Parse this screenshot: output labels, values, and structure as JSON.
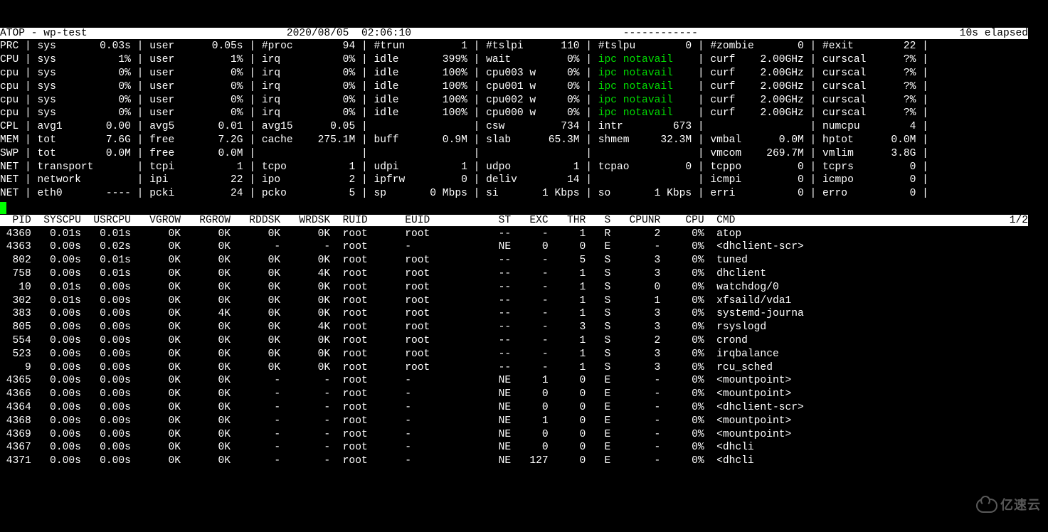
{
  "watermark": "亿速云",
  "header": {
    "left": "ATOP - wp-test",
    "date": "2020/08/05",
    "time": "02:06:10",
    "dashes": "------------",
    "elapsed": "10s elapsed"
  },
  "sys_rows": [
    {
      "tag": "PRC",
      "cols": [
        {
          "l": "sys",
          "v": "0.03s"
        },
        {
          "l": "user",
          "v": "0.05s"
        },
        {
          "l": "#proc",
          "v": "94"
        },
        {
          "l": "#trun",
          "v": "1"
        },
        {
          "l": "#tslpi",
          "v": "110"
        },
        {
          "l": "#tslpu",
          "v": "0"
        },
        {
          "l": "#zombie",
          "v": "0"
        },
        {
          "l": "#exit",
          "v": "22"
        }
      ]
    },
    {
      "tag": "CPU",
      "cols": [
        {
          "l": "sys",
          "v": "1%"
        },
        {
          "l": "user",
          "v": "1%"
        },
        {
          "l": "irq",
          "v": "0%"
        },
        {
          "l": "idle",
          "v": "399%"
        },
        {
          "l": "wait",
          "v": "0%"
        },
        {
          "l": "ipc notavail",
          "v": "",
          "g": true
        },
        {
          "l": "curf",
          "v": "2.00GHz"
        },
        {
          "l": "curscal",
          "v": "?%"
        }
      ]
    },
    {
      "tag": "cpu",
      "cols": [
        {
          "l": "sys",
          "v": "0%"
        },
        {
          "l": "user",
          "v": "0%"
        },
        {
          "l": "irq",
          "v": "0%"
        },
        {
          "l": "idle",
          "v": "100%"
        },
        {
          "l": "cpu003 w",
          "v": "0%"
        },
        {
          "l": "ipc notavail",
          "v": "",
          "g": true
        },
        {
          "l": "curf",
          "v": "2.00GHz"
        },
        {
          "l": "curscal",
          "v": "?%"
        }
      ]
    },
    {
      "tag": "cpu",
      "cols": [
        {
          "l": "sys",
          "v": "0%"
        },
        {
          "l": "user",
          "v": "0%"
        },
        {
          "l": "irq",
          "v": "0%"
        },
        {
          "l": "idle",
          "v": "100%"
        },
        {
          "l": "cpu001 w",
          "v": "0%"
        },
        {
          "l": "ipc notavail",
          "v": "",
          "g": true
        },
        {
          "l": "curf",
          "v": "2.00GHz"
        },
        {
          "l": "curscal",
          "v": "?%"
        }
      ]
    },
    {
      "tag": "cpu",
      "cols": [
        {
          "l": "sys",
          "v": "0%"
        },
        {
          "l": "user",
          "v": "0%"
        },
        {
          "l": "irq",
          "v": "0%"
        },
        {
          "l": "idle",
          "v": "100%"
        },
        {
          "l": "cpu002 w",
          "v": "0%"
        },
        {
          "l": "ipc notavail",
          "v": "",
          "g": true
        },
        {
          "l": "curf",
          "v": "2.00GHz"
        },
        {
          "l": "curscal",
          "v": "?%"
        }
      ]
    },
    {
      "tag": "cpu",
      "cols": [
        {
          "l": "sys",
          "v": "0%"
        },
        {
          "l": "user",
          "v": "0%"
        },
        {
          "l": "irq",
          "v": "0%"
        },
        {
          "l": "idle",
          "v": "100%"
        },
        {
          "l": "cpu000 w",
          "v": "0%"
        },
        {
          "l": "ipc notavail",
          "v": "",
          "g": true
        },
        {
          "l": "curf",
          "v": "2.00GHz"
        },
        {
          "l": "curscal",
          "v": "?%"
        }
      ]
    },
    {
      "tag": "CPL",
      "cols": [
        {
          "l": "avg1",
          "v": "0.00"
        },
        {
          "l": "avg5",
          "v": "0.01"
        },
        {
          "l": "avg15",
          "v": "0.05"
        },
        {
          "l": "",
          "v": ""
        },
        {
          "l": "csw",
          "v": "734"
        },
        {
          "l": "intr",
          "v": "673"
        },
        {
          "l": "",
          "v": ""
        },
        {
          "l": "numcpu",
          "v": "4"
        }
      ]
    },
    {
      "tag": "MEM",
      "cols": [
        {
          "l": "tot",
          "v": "7.6G"
        },
        {
          "l": "free",
          "v": "7.2G"
        },
        {
          "l": "cache",
          "v": "275.1M"
        },
        {
          "l": "buff",
          "v": "0.9M"
        },
        {
          "l": "slab",
          "v": "65.3M"
        },
        {
          "l": "shmem",
          "v": "32.3M"
        },
        {
          "l": "vmbal",
          "v": "0.0M"
        },
        {
          "l": "hptot",
          "v": "0.0M"
        }
      ]
    },
    {
      "tag": "SWP",
      "cols": [
        {
          "l": "tot",
          "v": "0.0M"
        },
        {
          "l": "free",
          "v": "0.0M"
        },
        {
          "l": "",
          "v": ""
        },
        {
          "l": "",
          "v": ""
        },
        {
          "l": "",
          "v": ""
        },
        {
          "l": "",
          "v": ""
        },
        {
          "l": "vmcom",
          "v": "269.7M"
        },
        {
          "l": "vmlim",
          "v": "3.8G"
        }
      ]
    },
    {
      "tag": "NET",
      "cols": [
        {
          "l": "transport",
          "v": ""
        },
        {
          "l": "tcpi",
          "v": "1"
        },
        {
          "l": "tcpo",
          "v": "1"
        },
        {
          "l": "udpi",
          "v": "1"
        },
        {
          "l": "udpo",
          "v": "1"
        },
        {
          "l": "tcpao",
          "v": "0"
        },
        {
          "l": "tcppo",
          "v": "0"
        },
        {
          "l": "tcprs",
          "v": "0"
        }
      ]
    },
    {
      "tag": "NET",
      "cols": [
        {
          "l": "network",
          "v": ""
        },
        {
          "l": "ipi",
          "v": "22"
        },
        {
          "l": "ipo",
          "v": "2"
        },
        {
          "l": "ipfrw",
          "v": "0"
        },
        {
          "l": "deliv",
          "v": "14"
        },
        {
          "l": "",
          "v": ""
        },
        {
          "l": "icmpi",
          "v": "0"
        },
        {
          "l": "icmpo",
          "v": "0"
        }
      ]
    },
    {
      "tag": "NET",
      "cols": [
        {
          "l": "eth0",
          "v": "----"
        },
        {
          "l": "pcki",
          "v": "24"
        },
        {
          "l": "pcko",
          "v": "5"
        },
        {
          "l": "sp",
          "v": "0 Mbps"
        },
        {
          "l": "si",
          "v": "1 Kbps"
        },
        {
          "l": "so",
          "v": "1 Kbps"
        },
        {
          "l": "erri",
          "v": "0"
        },
        {
          "l": "erro",
          "v": "0"
        }
      ]
    }
  ],
  "proc_header": {
    "columns": [
      "PID",
      "SYSCPU",
      "USRCPU",
      "VGROW",
      "RGROW",
      "RDDSK",
      "WRDSK",
      "RUID",
      "EUID",
      "ST",
      "EXC",
      "THR",
      "S",
      "CPUNR",
      "CPU",
      "CMD"
    ],
    "page": "1/2"
  },
  "procs": [
    {
      "pid": "4360",
      "syscpu": "0.01s",
      "usrcpu": "0.01s",
      "vgrow": "0K",
      "rgrow": "0K",
      "rddsk": "0K",
      "wrdsk": "0K",
      "ruid": "root",
      "euid": "root",
      "st": "--",
      "exc": "-",
      "thr": "1",
      "s": "R",
      "cpunr": "2",
      "cpu": "0%",
      "cmd": "atop"
    },
    {
      "pid": "4363",
      "syscpu": "0.00s",
      "usrcpu": "0.02s",
      "vgrow": "0K",
      "rgrow": "0K",
      "rddsk": "-",
      "wrdsk": "-",
      "ruid": "root",
      "euid": "-",
      "st": "NE",
      "exc": "0",
      "thr": "0",
      "s": "E",
      "cpunr": "-",
      "cpu": "0%",
      "cmd": "<dhclient-scr>"
    },
    {
      "pid": "802",
      "syscpu": "0.00s",
      "usrcpu": "0.01s",
      "vgrow": "0K",
      "rgrow": "0K",
      "rddsk": "0K",
      "wrdsk": "0K",
      "ruid": "root",
      "euid": "root",
      "st": "--",
      "exc": "-",
      "thr": "5",
      "s": "S",
      "cpunr": "3",
      "cpu": "0%",
      "cmd": "tuned"
    },
    {
      "pid": "758",
      "syscpu": "0.00s",
      "usrcpu": "0.01s",
      "vgrow": "0K",
      "rgrow": "0K",
      "rddsk": "0K",
      "wrdsk": "4K",
      "ruid": "root",
      "euid": "root",
      "st": "--",
      "exc": "-",
      "thr": "1",
      "s": "S",
      "cpunr": "3",
      "cpu": "0%",
      "cmd": "dhclient"
    },
    {
      "pid": "10",
      "syscpu": "0.01s",
      "usrcpu": "0.00s",
      "vgrow": "0K",
      "rgrow": "0K",
      "rddsk": "0K",
      "wrdsk": "0K",
      "ruid": "root",
      "euid": "root",
      "st": "--",
      "exc": "-",
      "thr": "1",
      "s": "S",
      "cpunr": "0",
      "cpu": "0%",
      "cmd": "watchdog/0"
    },
    {
      "pid": "302",
      "syscpu": "0.01s",
      "usrcpu": "0.00s",
      "vgrow": "0K",
      "rgrow": "0K",
      "rddsk": "0K",
      "wrdsk": "0K",
      "ruid": "root",
      "euid": "root",
      "st": "--",
      "exc": "-",
      "thr": "1",
      "s": "S",
      "cpunr": "1",
      "cpu": "0%",
      "cmd": "xfsaild/vda1"
    },
    {
      "pid": "383",
      "syscpu": "0.00s",
      "usrcpu": "0.00s",
      "vgrow": "0K",
      "rgrow": "4K",
      "rddsk": "0K",
      "wrdsk": "0K",
      "ruid": "root",
      "euid": "root",
      "st": "--",
      "exc": "-",
      "thr": "1",
      "s": "S",
      "cpunr": "3",
      "cpu": "0%",
      "cmd": "systemd-journa"
    },
    {
      "pid": "805",
      "syscpu": "0.00s",
      "usrcpu": "0.00s",
      "vgrow": "0K",
      "rgrow": "0K",
      "rddsk": "0K",
      "wrdsk": "4K",
      "ruid": "root",
      "euid": "root",
      "st": "--",
      "exc": "-",
      "thr": "3",
      "s": "S",
      "cpunr": "3",
      "cpu": "0%",
      "cmd": "rsyslogd"
    },
    {
      "pid": "554",
      "syscpu": "0.00s",
      "usrcpu": "0.00s",
      "vgrow": "0K",
      "rgrow": "0K",
      "rddsk": "0K",
      "wrdsk": "0K",
      "ruid": "root",
      "euid": "root",
      "st": "--",
      "exc": "-",
      "thr": "1",
      "s": "S",
      "cpunr": "2",
      "cpu": "0%",
      "cmd": "crond"
    },
    {
      "pid": "523",
      "syscpu": "0.00s",
      "usrcpu": "0.00s",
      "vgrow": "0K",
      "rgrow": "0K",
      "rddsk": "0K",
      "wrdsk": "0K",
      "ruid": "root",
      "euid": "root",
      "st": "--",
      "exc": "-",
      "thr": "1",
      "s": "S",
      "cpunr": "3",
      "cpu": "0%",
      "cmd": "irqbalance"
    },
    {
      "pid": "9",
      "syscpu": "0.00s",
      "usrcpu": "0.00s",
      "vgrow": "0K",
      "rgrow": "0K",
      "rddsk": "0K",
      "wrdsk": "0K",
      "ruid": "root",
      "euid": "root",
      "st": "--",
      "exc": "-",
      "thr": "1",
      "s": "S",
      "cpunr": "3",
      "cpu": "0%",
      "cmd": "rcu_sched"
    },
    {
      "pid": "4365",
      "syscpu": "0.00s",
      "usrcpu": "0.00s",
      "vgrow": "0K",
      "rgrow": "0K",
      "rddsk": "-",
      "wrdsk": "-",
      "ruid": "root",
      "euid": "-",
      "st": "NE",
      "exc": "1",
      "thr": "0",
      "s": "E",
      "cpunr": "-",
      "cpu": "0%",
      "cmd": "<mountpoint>"
    },
    {
      "pid": "4366",
      "syscpu": "0.00s",
      "usrcpu": "0.00s",
      "vgrow": "0K",
      "rgrow": "0K",
      "rddsk": "-",
      "wrdsk": "-",
      "ruid": "root",
      "euid": "-",
      "st": "NE",
      "exc": "0",
      "thr": "0",
      "s": "E",
      "cpunr": "-",
      "cpu": "0%",
      "cmd": "<mountpoint>"
    },
    {
      "pid": "4364",
      "syscpu": "0.00s",
      "usrcpu": "0.00s",
      "vgrow": "0K",
      "rgrow": "0K",
      "rddsk": "-",
      "wrdsk": "-",
      "ruid": "root",
      "euid": "-",
      "st": "NE",
      "exc": "0",
      "thr": "0",
      "s": "E",
      "cpunr": "-",
      "cpu": "0%",
      "cmd": "<dhclient-scr>"
    },
    {
      "pid": "4368",
      "syscpu": "0.00s",
      "usrcpu": "0.00s",
      "vgrow": "0K",
      "rgrow": "0K",
      "rddsk": "-",
      "wrdsk": "-",
      "ruid": "root",
      "euid": "-",
      "st": "NE",
      "exc": "1",
      "thr": "0",
      "s": "E",
      "cpunr": "-",
      "cpu": "0%",
      "cmd": "<mountpoint>"
    },
    {
      "pid": "4369",
      "syscpu": "0.00s",
      "usrcpu": "0.00s",
      "vgrow": "0K",
      "rgrow": "0K",
      "rddsk": "-",
      "wrdsk": "-",
      "ruid": "root",
      "euid": "-",
      "st": "NE",
      "exc": "0",
      "thr": "0",
      "s": "E",
      "cpunr": "-",
      "cpu": "0%",
      "cmd": "<mountpoint>"
    },
    {
      "pid": "4367",
      "syscpu": "0.00s",
      "usrcpu": "0.00s",
      "vgrow": "0K",
      "rgrow": "0K",
      "rddsk": "-",
      "wrdsk": "-",
      "ruid": "root",
      "euid": "-",
      "st": "NE",
      "exc": "0",
      "thr": "0",
      "s": "E",
      "cpunr": "-",
      "cpu": "0%",
      "cmd": "<dhcli"
    },
    {
      "pid": "4371",
      "syscpu": "0.00s",
      "usrcpu": "0.00s",
      "vgrow": "0K",
      "rgrow": "0K",
      "rddsk": "-",
      "wrdsk": "-",
      "ruid": "root",
      "euid": "-",
      "st": "NE",
      "exc": "127",
      "thr": "0",
      "s": "E",
      "cpunr": "-",
      "cpu": "0%",
      "cmd": "<dhcli"
    }
  ]
}
